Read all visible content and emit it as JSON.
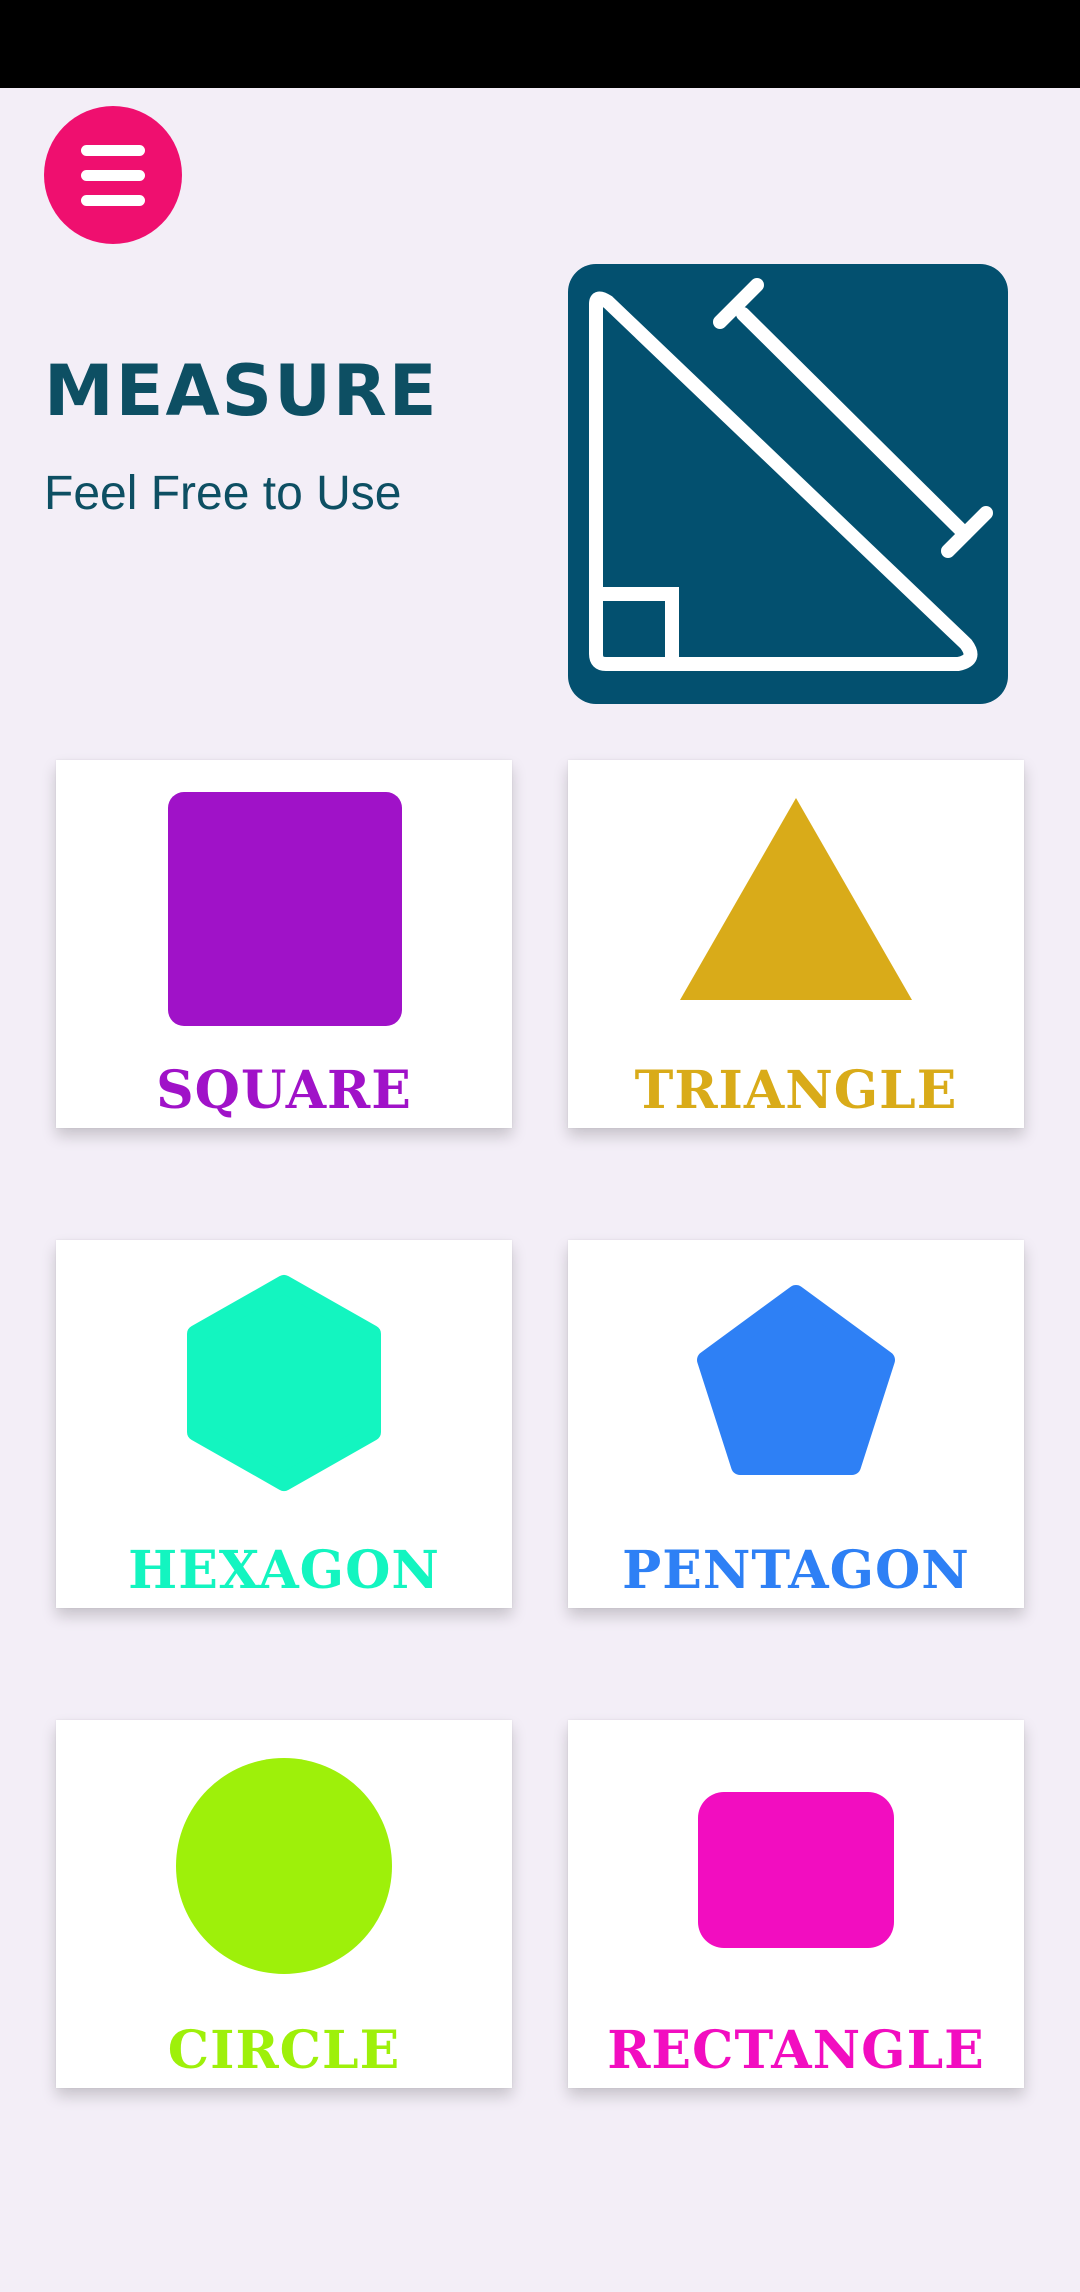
{
  "header": {
    "title": "MEASURE",
    "subtitle": "Feel Free to Use",
    "menu_icon": "hamburger-menu-icon",
    "logo_icon": "ruler-triangle-icon",
    "accent_color": "#ef0f6f",
    "brand_color": "#03506f"
  },
  "shapes": [
    {
      "label": "SQUARE",
      "icon": "square-icon",
      "color": "#a012c8"
    },
    {
      "label": "TRIANGLE",
      "icon": "triangle-icon",
      "color": "#d9ab19"
    },
    {
      "label": "HEXAGON",
      "icon": "hexagon-icon",
      "color": "#13f5c0"
    },
    {
      "label": "PENTAGON",
      "icon": "pentagon-icon",
      "color": "#2e80f5"
    },
    {
      "label": "CIRCLE",
      "icon": "circle-icon",
      "color": "#9ef00a"
    },
    {
      "label": "RECTANGLE",
      "icon": "rectangle-icon",
      "color": "#f20dc0"
    }
  ]
}
